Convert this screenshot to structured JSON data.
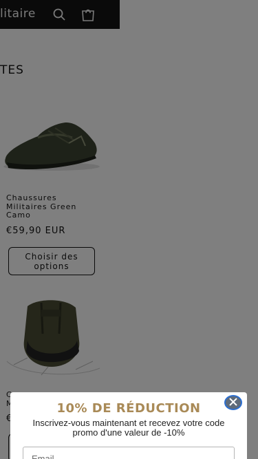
{
  "header": {
    "brand": "litaire",
    "search_icon": "search-icon",
    "cart_icon": "cart-icon"
  },
  "collection": {
    "title": "TES"
  },
  "products": [
    {
      "name": "Chaussures Militaires Green Camo",
      "price": "€59,90 EUR",
      "button_label": "Choisir des options"
    },
    {
      "name": "C\nM",
      "price": "€",
      "button_label": ""
    }
  ],
  "popup": {
    "title": "10% DE RÉDUCTION",
    "text": "Inscrivez-vous maintenant et recevez votre code promo d'une valeur de -10%",
    "email_placeholder": "Email",
    "close_icon": "close-icon",
    "title_color": "#a98a57"
  },
  "colors": {
    "header_bg": "#141414",
    "overlay": "rgba(0,0,0,0.5)"
  }
}
